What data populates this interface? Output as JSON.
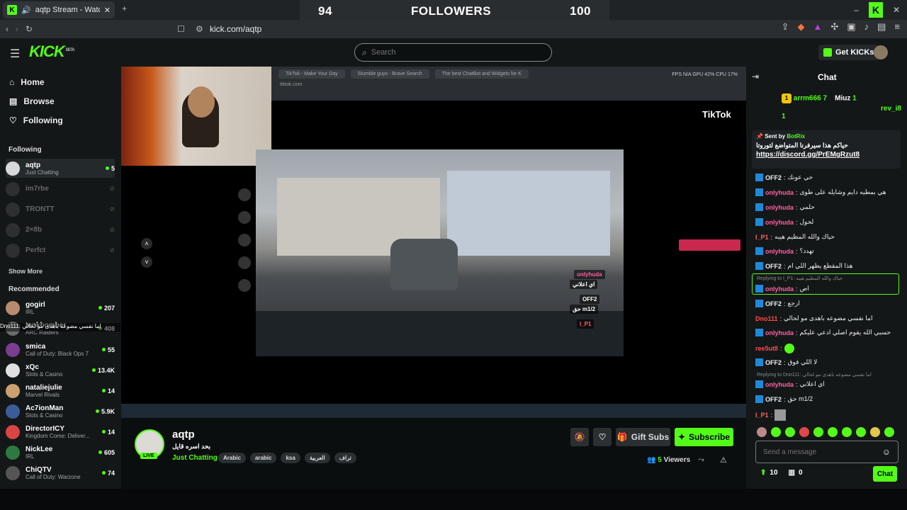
{
  "browser": {
    "tab_title": "aqtp Stream - Watch Live on",
    "url": "kick.com/aqtp"
  },
  "counter": {
    "left": "94",
    "label": "FOLLOWERS",
    "right": "100"
  },
  "header": {
    "logo": "KICK",
    "logo_beta": "BETA",
    "search_placeholder": "Search",
    "get_kicks": "Get KICKs"
  },
  "sidebar": {
    "nav": [
      "Home",
      "Browse",
      "Following"
    ],
    "following_title": "Following",
    "following": [
      {
        "name": "aqtp",
        "category": "Just Chatting",
        "viewers": "5",
        "live": true
      },
      {
        "name": "im7rbe",
        "live": false
      },
      {
        "name": "TRONTT",
        "live": false
      },
      {
        "name": "2×8b",
        "live": false
      },
      {
        "name": "Perfct",
        "live": false
      }
    ],
    "show_more": "Show More",
    "recommended_title": "Recommended",
    "recommended": [
      {
        "name": "gogirl",
        "category": "IRL",
        "viewers": "207"
      },
      {
        "name": "tankbomber",
        "category": "ARC Raiders",
        "viewers": "408"
      },
      {
        "name": "smica",
        "category": "Call of Duty: Black Ops 7",
        "viewers": "55"
      },
      {
        "name": "xQc",
        "category": "Slots & Casino",
        "viewers": "13.4K"
      },
      {
        "name": "nataliejulie",
        "category": "Marvel Rivals",
        "viewers": "14"
      },
      {
        "name": "Ac7ionMan",
        "category": "Slots & Casino",
        "viewers": "5.9K"
      },
      {
        "name": "DirectorICY",
        "category": "Kingdom Come: Deliver...",
        "viewers": "14"
      },
      {
        "name": "NickLee",
        "category": "IRL",
        "viewers": "605"
      },
      {
        "name": "ChiQTV",
        "category": "Call of Duty: Warzone",
        "viewers": "74"
      }
    ],
    "ticker": "Dno111: اما نفسي مضوعه باهدى مو لحالي"
  },
  "stream": {
    "screen_tabs": [
      "TikTok - Make Your Day",
      "Stumble guys - Brave Search",
      "The best ChatBot and Widgets for K"
    ],
    "screen_url": "tiktok.com",
    "screen_stats": "FPS N/A   GPU 42%   CPU 17%",
    "tiktok_logo": "TikTok",
    "overlay": [
      {
        "user": "onlyhuda",
        "text": "اي اعلاني"
      },
      {
        "user": "OFF2",
        "text": "حق m1/2"
      },
      {
        "user": "I_P1",
        "text": ""
      }
    ]
  },
  "info": {
    "streamer": "aqtp",
    "live": "LIVE",
    "title": "بحد اسره قايل",
    "category": "Just Chatting",
    "tags": [
      "Arabic",
      "arabic",
      "ksa",
      "العربية",
      "تراف"
    ],
    "gift_subs": "Gift Subs",
    "subscribe": "Subscribe",
    "viewers_count": "5",
    "viewers_label": "Viewers"
  },
  "chat": {
    "title": "Chat",
    "leaders": [
      {
        "name": "arrm666",
        "count": "7",
        "rank": "1"
      },
      {
        "name": "Miuz",
        "count": "1"
      },
      {
        "name": "rev_i8",
        "count": "1"
      }
    ],
    "pinned": {
      "sent_by": "Sent by",
      "bot": "BotRix",
      "text": "حياكم هذا سيرفرنا المتواضع لتوروتا",
      "link": "https://discord.gg/PrEMgRzut8"
    },
    "messages": [
      {
        "user": "OFF2",
        "color": "#ffffff",
        "text": "حي عونك"
      },
      {
        "user": "onlyhuda",
        "color": "#ff5fa2",
        "text": "هي بمطيه دايم وشايله على طوى"
      },
      {
        "user": "onlyhuda",
        "color": "#ff5fa2",
        "text": "حلمي"
      },
      {
        "user": "onlyhuda",
        "color": "#ff5fa2",
        "text": "لحول"
      },
      {
        "user": "I_P1",
        "color": "#ff5f5f",
        "text": "حياك والله المظيم هيبه"
      },
      {
        "user": "onlyhuda",
        "color": "#ff5fa2",
        "text": "تهدد؟"
      },
      {
        "user": "OFF2",
        "color": "#ffffff",
        "text": "هذا المقطع يظهر اللي ام"
      },
      {
        "user": "onlyhuda",
        "color": "#ff5fa2",
        "text": "اص"
      },
      {
        "user": "OFF2",
        "color": "#ffffff",
        "text": "ارجع"
      },
      {
        "user": "Dno111",
        "color": "#ff4b4b",
        "text": "اما نفسي مضوعه باهدى مو لحالي"
      },
      {
        "user": "onlyhuda",
        "color": "#ff5fa2",
        "text": "حسبي الله يقوم اصلي ادعي عليكم"
      },
      {
        "user": "ree5ut8",
        "color": "#ff4b4b",
        "text": ""
      },
      {
        "user": "OFF2",
        "color": "#ffffff",
        "text": "لا اللي فوق"
      },
      {
        "user": "onlyhuda",
        "color": "#ff5fa2",
        "text": "اي اعلاني"
      },
      {
        "user": "OFF2",
        "color": "#ffffff",
        "text": "حق m1/2"
      },
      {
        "user": "I_P1",
        "color": "#ff5f5f",
        "text": ""
      }
    ],
    "reply_1": "Replying to I_P1: حياك والله المظيم هيبه",
    "reply_2": "Replying to Dno111: اما نفسي مضوعه باهدى مو لحالي",
    "input_placeholder": "Send a message",
    "kicks": "10",
    "points": "0",
    "send": "Chat"
  }
}
